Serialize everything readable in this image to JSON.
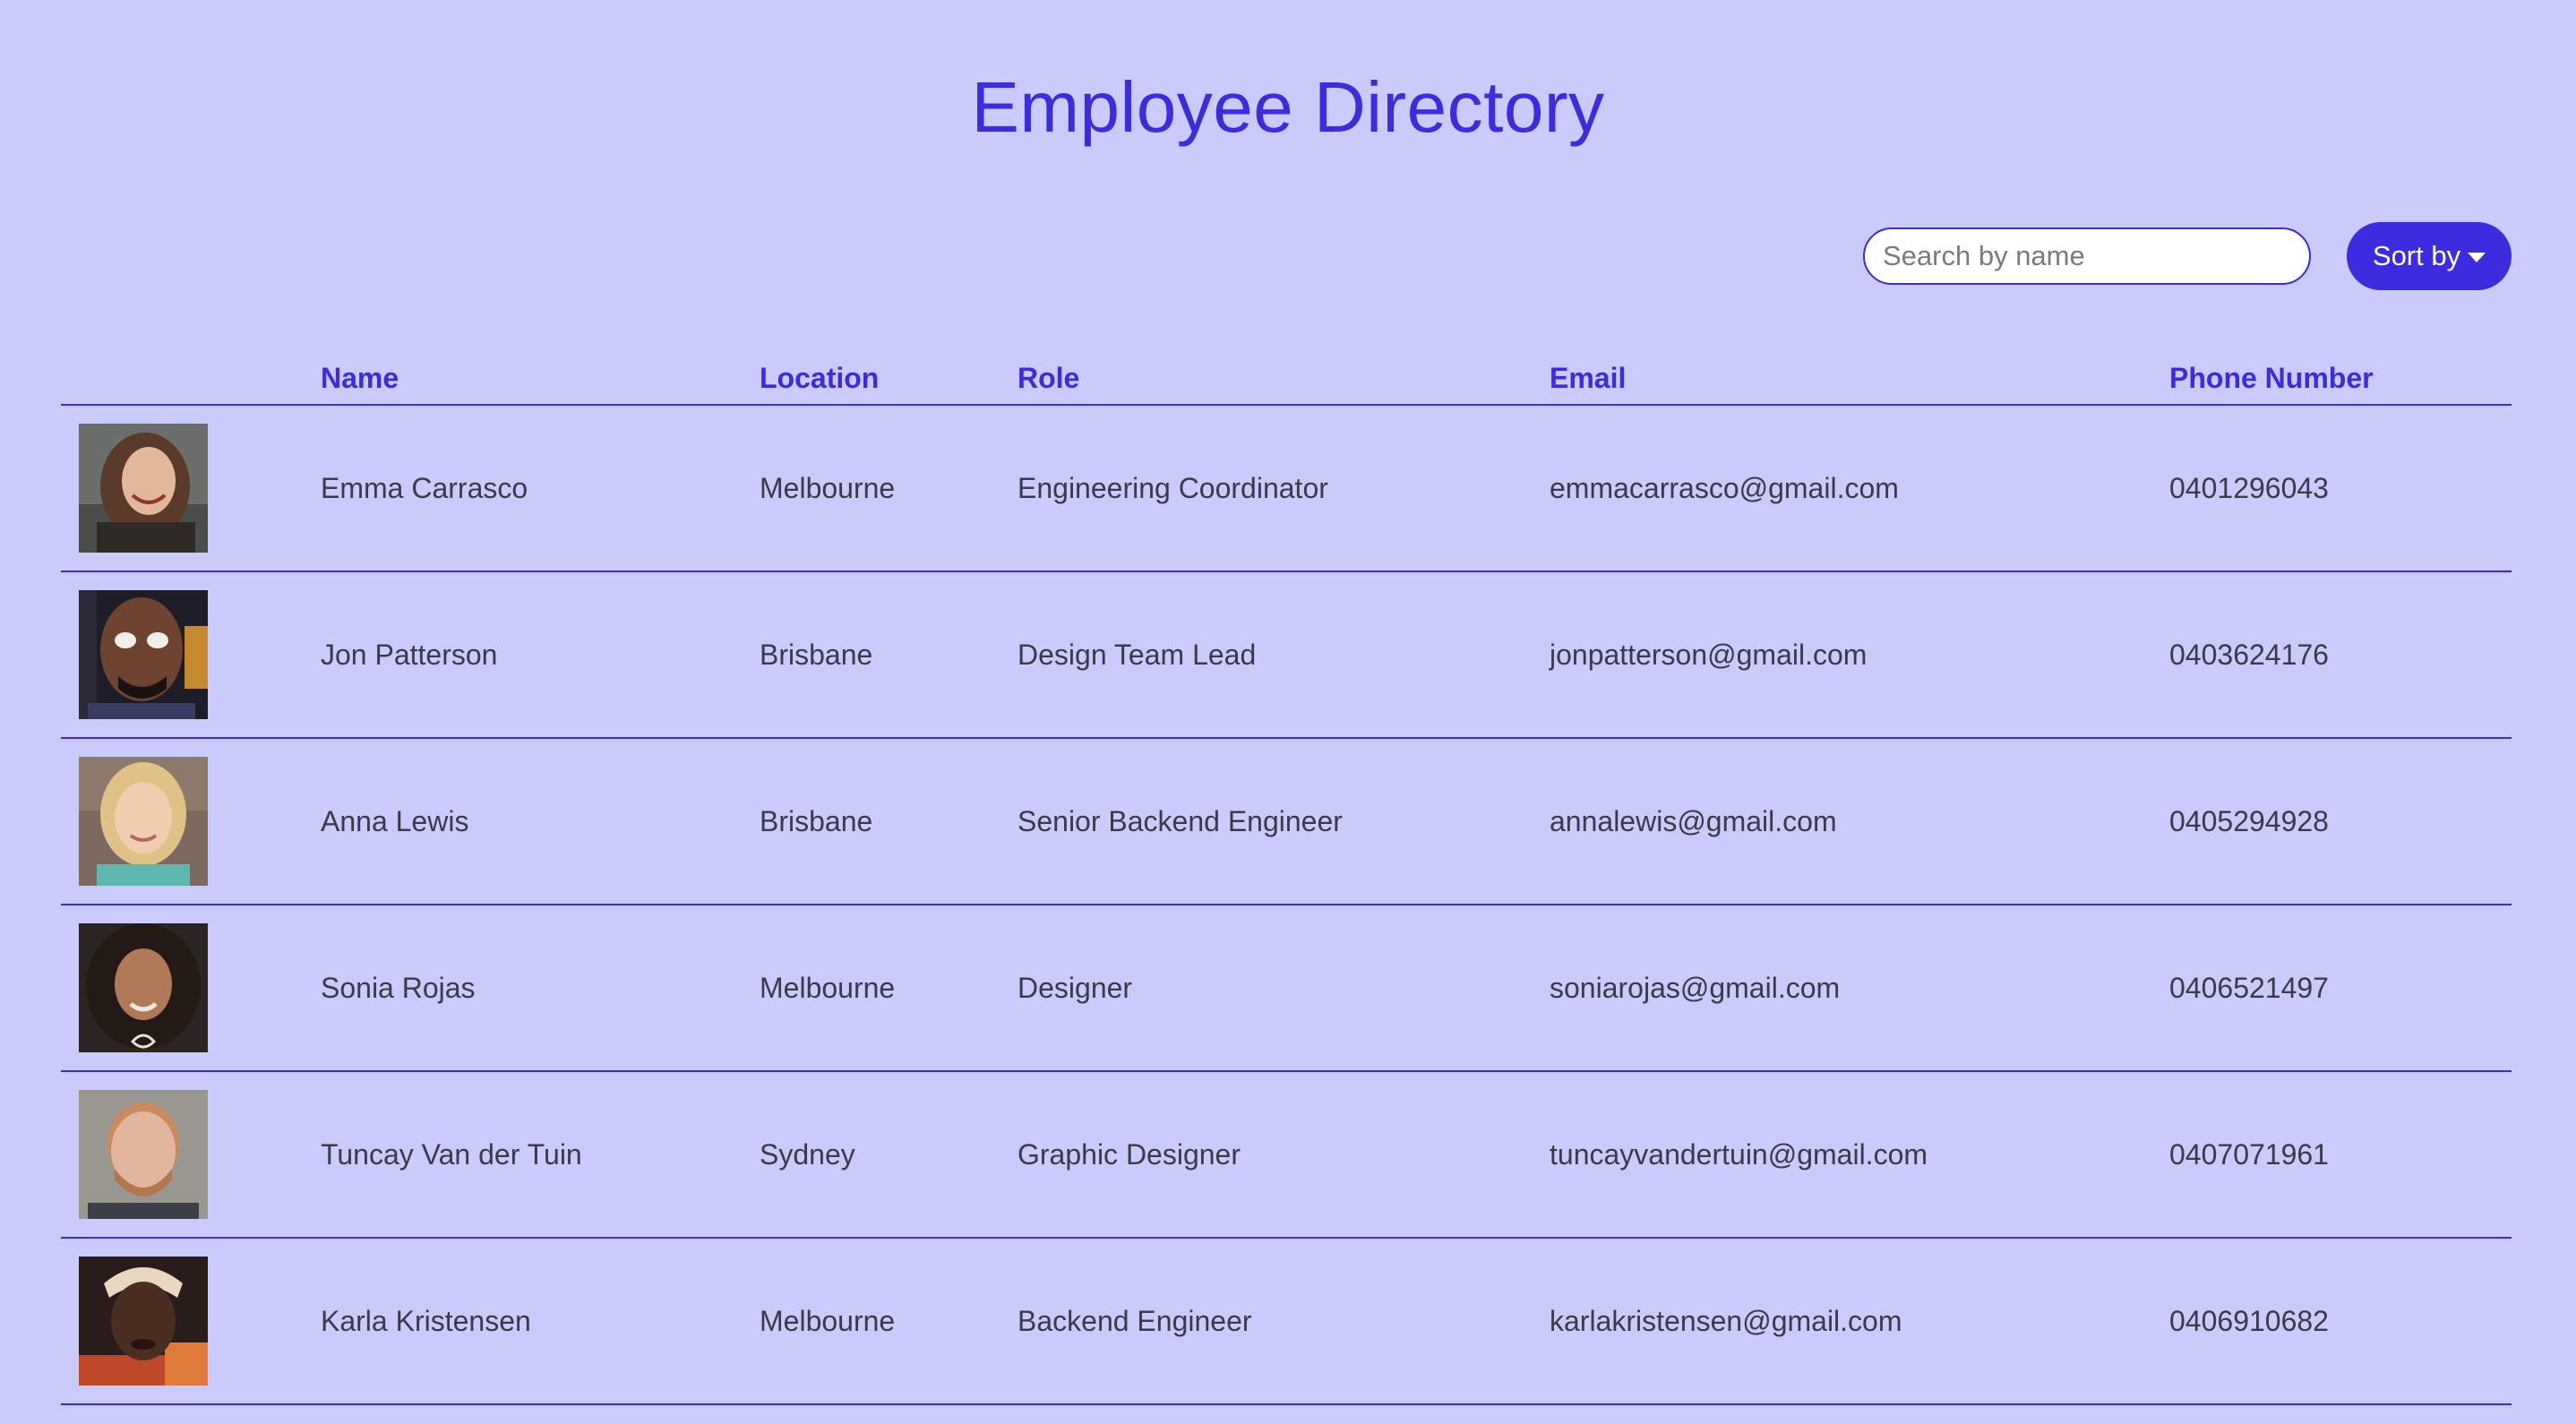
{
  "page": {
    "title": "Employee Directory"
  },
  "search": {
    "placeholder": "Search by name",
    "value": ""
  },
  "sort": {
    "label": "Sort by"
  },
  "table": {
    "headers": {
      "name": "Name",
      "location": "Location",
      "role": "Role",
      "email": "Email",
      "phone": "Phone Number"
    },
    "rows": [
      {
        "name": "Emma Carrasco",
        "location": "Melbourne",
        "role": "Engineering Coordinator",
        "email": "emmacarrasco@gmail.com",
        "phone": "0401296043"
      },
      {
        "name": "Jon Patterson",
        "location": "Brisbane",
        "role": "Design Team Lead",
        "email": "jonpatterson@gmail.com",
        "phone": "0403624176"
      },
      {
        "name": "Anna Lewis",
        "location": "Brisbane",
        "role": "Senior Backend Engineer",
        "email": "annalewis@gmail.com",
        "phone": "0405294928"
      },
      {
        "name": "Sonia Rojas",
        "location": "Melbourne",
        "role": "Designer",
        "email": "soniarojas@gmail.com",
        "phone": "0406521497"
      },
      {
        "name": "Tuncay Van der Tuin",
        "location": "Sydney",
        "role": "Graphic Designer",
        "email": "tuncayvandertuin@gmail.com",
        "phone": "0407071961"
      },
      {
        "name": "Karla Kristensen",
        "location": "Melbourne",
        "role": "Backend Engineer",
        "email": "karlakristensen@gmail.com",
        "phone": "0406910682"
      }
    ]
  },
  "colors": {
    "background": "#cacbfa",
    "accent": "#3d2be0",
    "text": "#3a3a48"
  }
}
